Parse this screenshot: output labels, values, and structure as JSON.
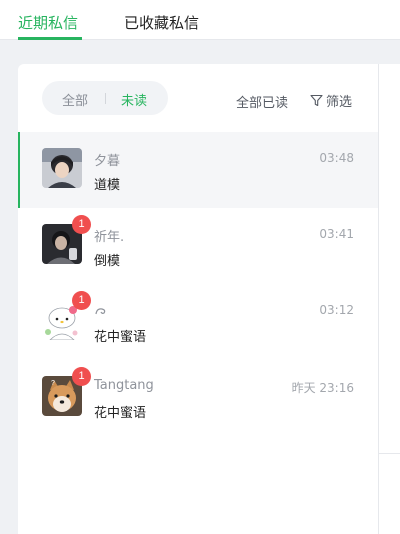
{
  "tabs": [
    {
      "label": "近期私信",
      "active": true
    },
    {
      "label": "已收藏私信",
      "active": false
    }
  ],
  "filter": {
    "options": [
      "全部",
      "未读"
    ],
    "selected": "未读",
    "mark_all_read": "全部已读",
    "filter_label": "筛选"
  },
  "conversations": [
    {
      "name": "夕暮",
      "time": "03:48",
      "preview": "道模",
      "unread": null,
      "selected": true,
      "avatar": "portrait-photo"
    },
    {
      "name": "祈年.",
      "time": "03:41",
      "preview": "倒模",
      "unread": "1",
      "selected": false,
      "avatar": "dark-portrait"
    },
    {
      "name": "",
      "time": "03:12",
      "preview": "花中蜜语",
      "unread": "1",
      "selected": false,
      "avatar": "hello-kitty"
    },
    {
      "name": "Tangtang",
      "time": "昨天 23:16",
      "preview": "花中蜜语",
      "unread": "1",
      "selected": false,
      "avatar": "shiba-dog"
    }
  ],
  "colors": {
    "accent": "#27b45f",
    "badge": "#f04f4f"
  }
}
